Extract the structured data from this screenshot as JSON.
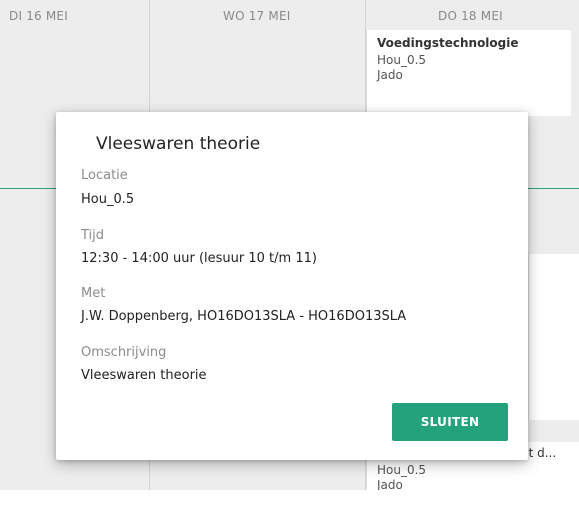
{
  "calendar": {
    "columns": [
      {
        "header": "DI 16 MEI"
      },
      {
        "header": "WO 17 MEI"
      },
      {
        "header": "DO 18 MEI"
      }
    ],
    "events": [
      {
        "title": "Voedingstechnologie",
        "location": "Hou_0.5",
        "teacher": "Jado"
      },
      {
        "title": "Nederlands / rekenen met d...",
        "location": "Hou_0.5",
        "teacher": "Jado"
      }
    ],
    "accent_color": "#2aa37f"
  },
  "modal": {
    "title": "Vleeswaren theorie",
    "fields": [
      {
        "label": "Locatie",
        "value": "Hou_0.5"
      },
      {
        "label": "Tijd",
        "value": "12:30 - 14:00 uur (lesuur 10 t/m 11)"
      },
      {
        "label": "Met",
        "value": "J.W. Doppenberg, HO16DO13SLA - HO16DO13SLA"
      },
      {
        "label": "Omschrijving",
        "value": "Vleeswaren theorie"
      }
    ],
    "close_label": "SLUITEN",
    "button_color": "#24a27b"
  }
}
